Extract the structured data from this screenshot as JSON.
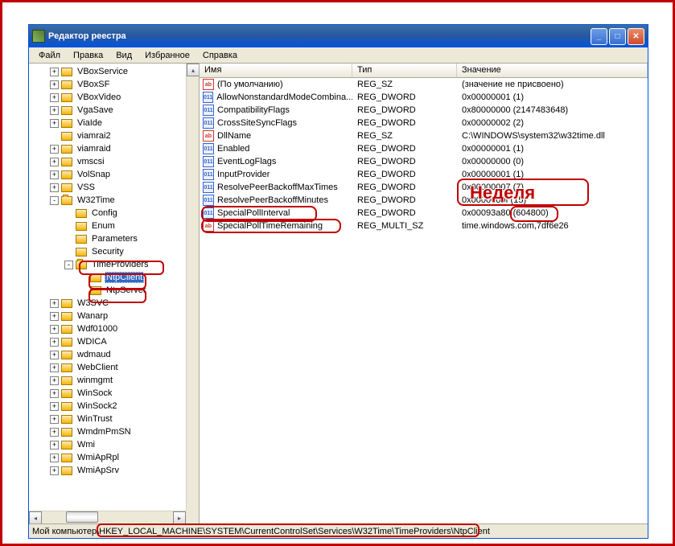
{
  "window": {
    "title": "Редактор реестра",
    "menu": {
      "file": "Файл",
      "edit": "Правка",
      "view": "Вид",
      "favorites": "Избранное",
      "help": "Справка"
    }
  },
  "list_headers": {
    "name": "Имя",
    "type": "Тип",
    "value": "Значение"
  },
  "tree": [
    {
      "indent": 0,
      "exp": "+",
      "label": "VBoxService"
    },
    {
      "indent": 0,
      "exp": "+",
      "label": "VBoxSF"
    },
    {
      "indent": 0,
      "exp": "+",
      "label": "VBoxVideo"
    },
    {
      "indent": 0,
      "exp": "+",
      "label": "VgaSave"
    },
    {
      "indent": 0,
      "exp": "+",
      "label": "ViaIde"
    },
    {
      "indent": 0,
      "exp": "",
      "label": "viamrai2"
    },
    {
      "indent": 0,
      "exp": "+",
      "label": "viamraid"
    },
    {
      "indent": 0,
      "exp": "+",
      "label": "vmscsi"
    },
    {
      "indent": 0,
      "exp": "+",
      "label": "VolSnap"
    },
    {
      "indent": 0,
      "exp": "+",
      "label": "VSS"
    },
    {
      "indent": 0,
      "exp": "-",
      "label": "W32Time"
    },
    {
      "indent": 1,
      "exp": "",
      "label": "Config"
    },
    {
      "indent": 1,
      "exp": "",
      "label": "Enum"
    },
    {
      "indent": 1,
      "exp": "",
      "label": "Parameters"
    },
    {
      "indent": 1,
      "exp": "",
      "label": "Security"
    },
    {
      "indent": 1,
      "exp": "-",
      "label": "TimeProviders"
    },
    {
      "indent": 2,
      "exp": "",
      "label": "NtpClient",
      "selected": true
    },
    {
      "indent": 2,
      "exp": "",
      "label": "NtpServer"
    },
    {
      "indent": 0,
      "exp": "+",
      "label": "W3SVC"
    },
    {
      "indent": 0,
      "exp": "+",
      "label": "Wanarp"
    },
    {
      "indent": 0,
      "exp": "+",
      "label": "Wdf01000"
    },
    {
      "indent": 0,
      "exp": "+",
      "label": "WDICA"
    },
    {
      "indent": 0,
      "exp": "+",
      "label": "wdmaud"
    },
    {
      "indent": 0,
      "exp": "+",
      "label": "WebClient"
    },
    {
      "indent": 0,
      "exp": "+",
      "label": "winmgmt"
    },
    {
      "indent": 0,
      "exp": "+",
      "label": "WinSock"
    },
    {
      "indent": 0,
      "exp": "+",
      "label": "WinSock2"
    },
    {
      "indent": 0,
      "exp": "+",
      "label": "WinTrust"
    },
    {
      "indent": 0,
      "exp": "+",
      "label": "WmdmPmSN"
    },
    {
      "indent": 0,
      "exp": "+",
      "label": "Wmi"
    },
    {
      "indent": 0,
      "exp": "+",
      "label": "WmiApRpl"
    },
    {
      "indent": 0,
      "exp": "+",
      "label": "WmiApSrv"
    }
  ],
  "values": [
    {
      "icon": "sz",
      "name": "(По умолчанию)",
      "type": "REG_SZ",
      "value": "(значение не присвоено)"
    },
    {
      "icon": "bin",
      "name": "AllowNonstandardModeCombina...",
      "type": "REG_DWORD",
      "value": "0x00000001 (1)"
    },
    {
      "icon": "bin",
      "name": "CompatibilityFlags",
      "type": "REG_DWORD",
      "value": "0x80000000 (2147483648)"
    },
    {
      "icon": "bin",
      "name": "CrossSiteSyncFlags",
      "type": "REG_DWORD",
      "value": "0x00000002 (2)"
    },
    {
      "icon": "sz",
      "name": "DllName",
      "type": "REG_SZ",
      "value": "C:\\WINDOWS\\system32\\w32time.dll"
    },
    {
      "icon": "bin",
      "name": "Enabled",
      "type": "REG_DWORD",
      "value": "0x00000001 (1)"
    },
    {
      "icon": "bin",
      "name": "EventLogFlags",
      "type": "REG_DWORD",
      "value": "0x00000000 (0)"
    },
    {
      "icon": "bin",
      "name": "InputProvider",
      "type": "REG_DWORD",
      "value": "0x00000001 (1)"
    },
    {
      "icon": "bin",
      "name": "ResolvePeerBackoffMaxTimes",
      "type": "REG_DWORD",
      "value": "0x00000007 (7)"
    },
    {
      "icon": "bin",
      "name": "ResolvePeerBackoffMinutes",
      "type": "REG_DWORD",
      "value": "0x0000000f (15)"
    },
    {
      "icon": "bin",
      "name": "SpecialPollInterval",
      "type": "REG_DWORD",
      "value": "0x00093a80 (604800)"
    },
    {
      "icon": "sz",
      "name": "SpecialPollTimeRemaining",
      "type": "REG_MULTI_SZ",
      "value": "time.windows.com,7df6e26"
    }
  ],
  "statusbar": {
    "prefix": "Мой компьютер",
    "path": "\\HKEY_LOCAL_MACHINE\\SYSTEM\\CurrentControlSet\\Services\\W32Time\\TimeProviders\\NtpClient"
  },
  "annotation": "Неделя"
}
